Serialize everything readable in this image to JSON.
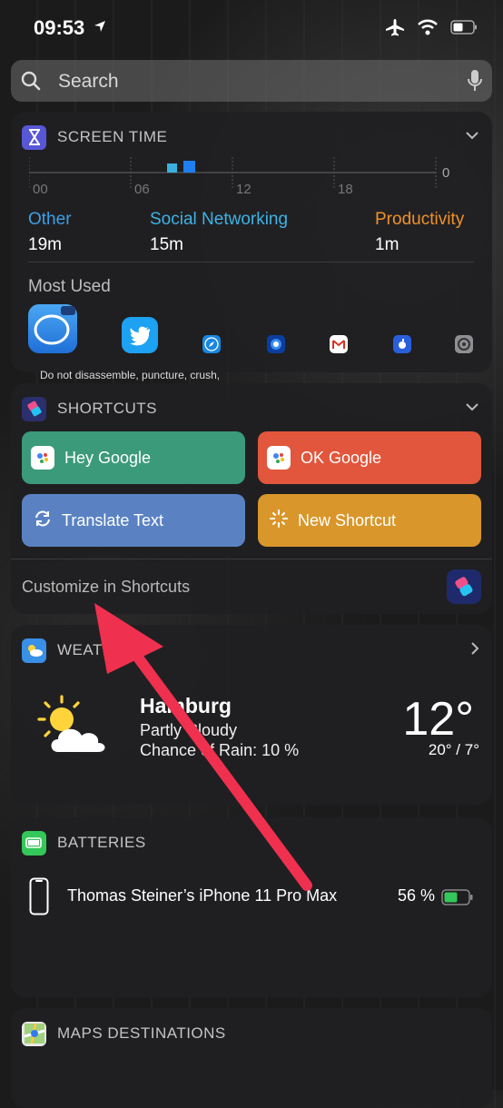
{
  "status_bar": {
    "time": "09:53"
  },
  "search": {
    "placeholder": "Search"
  },
  "screen_time": {
    "title": "SCREEN TIME",
    "axis": {
      "max_label": "0",
      "ticks": [
        "00",
        "06",
        "12",
        "18"
      ]
    },
    "categories": [
      {
        "name": "Other",
        "value": "19m",
        "color": "#3d9fe8"
      },
      {
        "name": "Social Networking",
        "value": "15m",
        "color": "#3eb2e5"
      },
      {
        "name": "Productivity",
        "value": "1m",
        "color": "#f0922b"
      }
    ],
    "most_used_label": "Most Used",
    "bar_colors": [
      "#3ab1e0",
      "#1f7ef0"
    ]
  },
  "wallpaper_text": "Do not disassemble, puncture, crush,",
  "shortcuts": {
    "title": "SHORTCUTS",
    "buttons": [
      {
        "label": "Hey Google",
        "color": "#3b9a7a"
      },
      {
        "label": "OK Google",
        "color": "#e1563c"
      },
      {
        "label": "Translate Text",
        "color": "#5a82c3"
      },
      {
        "label": "New Shortcut",
        "color": "#d9962a"
      }
    ],
    "customize": "Customize in Shortcuts"
  },
  "weather": {
    "title": "WEATHER",
    "city": "Hamburg",
    "condition": "Partly Cloudy",
    "rain": "Chance of Rain: 10 %",
    "temp": "12°",
    "hilo": "20° / 7°"
  },
  "batteries": {
    "title": "BATTERIES",
    "device": "Thomas Steiner’s iPhone 11 Pro Max",
    "percent": "56 %",
    "level": 0.56
  },
  "maps": {
    "title": "MAPS DESTINATIONS"
  }
}
